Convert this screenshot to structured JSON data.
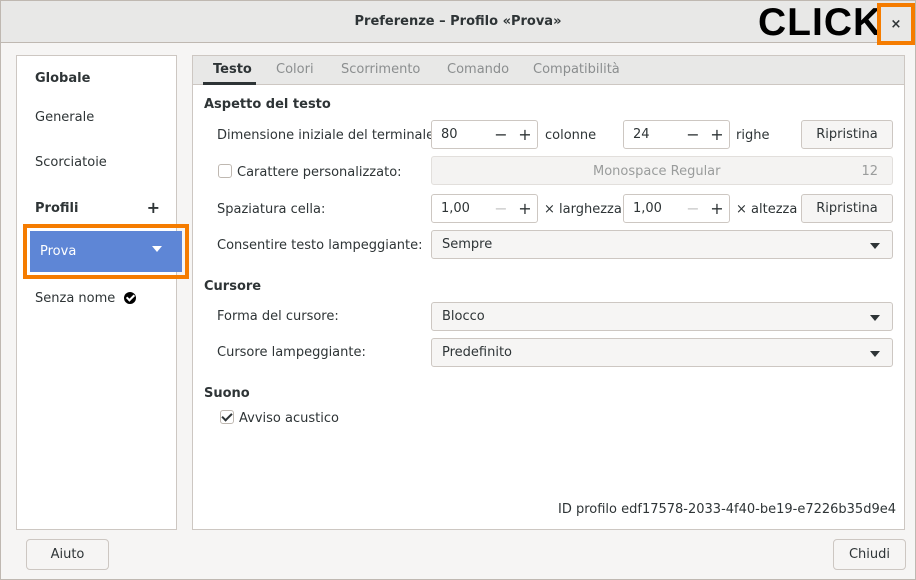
{
  "window": {
    "title": "Preferenze – Profilo «Prova»"
  },
  "annotation": {
    "click_label": "CLICK"
  },
  "header": {
    "close_glyph": "×"
  },
  "sidebar": {
    "global_heading": "Globale",
    "items": [
      "Generale",
      "Scorciatoie"
    ],
    "profiles_heading": "Profili",
    "add_glyph": "+",
    "profiles": [
      {
        "label": "Prova",
        "selected": true
      },
      {
        "label": "Senza nome",
        "default": true
      }
    ]
  },
  "tabs": [
    "Testo",
    "Colori",
    "Scorrimento",
    "Comando",
    "Compatibilità"
  ],
  "text_section": {
    "title": "Aspetto del testo",
    "initial_size_label": "Dimensione iniziale del terminale:",
    "columns_value": "80",
    "columns_unit": "colonne",
    "rows_value": "24",
    "rows_unit": "righe",
    "reset_label": "Ripristina",
    "custom_font_label": "Carattere personalizzato:",
    "custom_font_checked": false,
    "font_name": "Monospace Regular",
    "font_size": "12",
    "cell_spacing_label": "Spaziatura cella:",
    "width_value": "1,00",
    "width_unit": "× larghezza",
    "height_value": "1,00",
    "height_unit": "× altezza",
    "reset_label_2": "Ripristina",
    "blink_label": "Consentire testo lampeggiante:",
    "blink_value": "Sempre"
  },
  "cursor_section": {
    "title": "Cursore",
    "shape_label": "Forma del cursore:",
    "shape_value": "Blocco",
    "blink_label": "Cursore lampeggiante:",
    "blink_value": "Predefinito"
  },
  "sound_section": {
    "title": "Suono",
    "bell_label": "Avviso acustico",
    "bell_checked": true
  },
  "profile_id": "ID profilo  edf17578-2033-4f40-be19-e7226b35d9e4",
  "spin": {
    "minus": "−",
    "plus": "+"
  },
  "footer": {
    "help_label": "Aiuto",
    "close_label": "Chiudi"
  },
  "colors": {
    "accent": "#5e86d6",
    "highlight": "#f57c00"
  }
}
